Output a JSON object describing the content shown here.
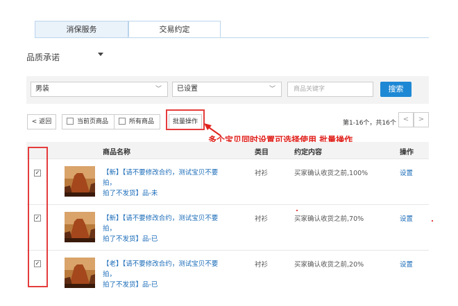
{
  "tabs": [
    {
      "label": "消保服务"
    },
    {
      "label": "交易约定"
    }
  ],
  "quality_dropdown": {
    "label": "品质承诺"
  },
  "search": {
    "category_value": "男装",
    "status_value": "已设置",
    "keyword_placeholder": "商品关键字",
    "button_label": "搜索"
  },
  "toolbar": {
    "back_label": "< 返回",
    "current_page_label": "当前页商品",
    "all_items_label": "所有商品",
    "batch_label": "批量操作",
    "pagination_text": "第1-16个，共16个",
    "prev_label": "<",
    "next_label": ">"
  },
  "annotation": "多个宝贝同时设置可选择使用  批量操作",
  "table": {
    "headers": {
      "name": "商品名称",
      "category": "类目",
      "agreement": "约定内容",
      "action": "操作"
    },
    "rows": [
      {
        "checked": "✓",
        "name_line1": "【新】【请不要修改合约，测试宝贝不要拍，",
        "name_line2": "拍了不发货】品-未",
        "category": "衬衫",
        "agreement": "买家确认收货之前,100%",
        "action": "设置"
      },
      {
        "checked": "✓",
        "name_line1": "【新】【请不要修改合约，测试宝贝不要拍，",
        "name_line2": "拍了不发货】品-已",
        "category": "衬衫",
        "agreement": "买家确认收货之前,70%",
        "action": "设置"
      },
      {
        "checked": "✓",
        "name_line1": "【老】【请不要修改合约，测试宝贝不要拍，",
        "name_line2": "拍了不发货】品-已",
        "category": "衬衫",
        "agreement": "买家确认收货之前,20%",
        "action": "设置"
      }
    ]
  },
  "colors": {
    "accent": "#1e88d4",
    "annotation": "#e0211c",
    "link": "#1a6bb8"
  }
}
